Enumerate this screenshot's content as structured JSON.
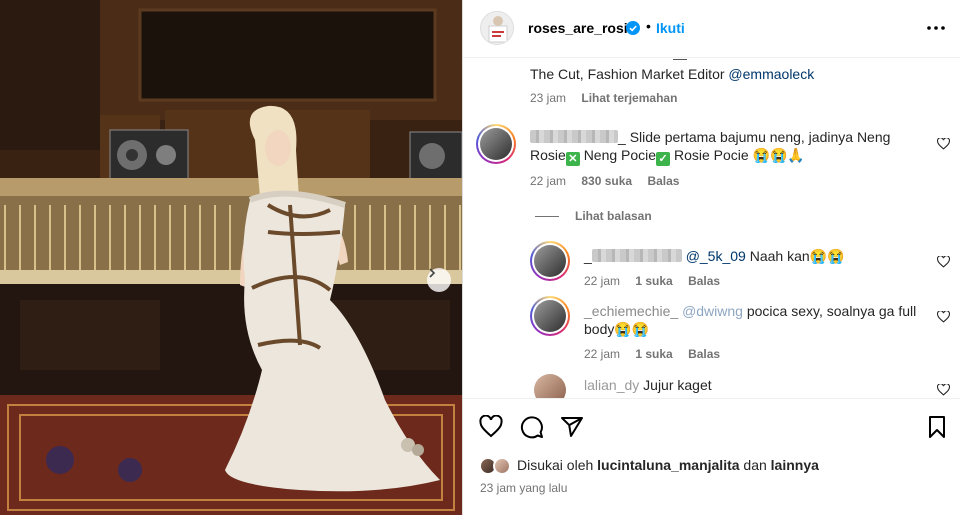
{
  "header": {
    "username": "roses_are_rosie",
    "separator": "•",
    "follow_label": "Ikuti"
  },
  "caption": {
    "line": "The Cut, Fashion Market Editor",
    "mention": "@emmaoleck",
    "time": "23 jam",
    "translate_label": "Lihat terjemahan"
  },
  "comments": [
    {
      "username_suffix": "_",
      "text_line1": "Slide pertama bajumu neng, jadinya Neng",
      "text_line2_a": "Rosie",
      "text_line2_b": "Neng Pocie",
      "text_line2_c": "Rosie Pocie 😭😭🙏",
      "time": "22 jam",
      "likes": "830 suka",
      "reply_label": "Balas"
    }
  ],
  "view_replies_label": "Lihat balasan",
  "replies": [
    {
      "username": "_",
      "mention": "@_5k_09",
      "text": "Naah kan😭😭",
      "time": "22 jam",
      "likes": "1 suka",
      "reply_label": "Balas"
    },
    {
      "username": "_echiemechie_",
      "mention": "@dwiwng",
      "text_line1": "pocica sexy, soalnya ga full",
      "text_line2": "body😭😭",
      "time": "22 jam",
      "likes": "1 suka",
      "reply_label": "Balas"
    }
  ],
  "last_comment": {
    "username": "lalian_dy",
    "text": "Jujur kaget"
  },
  "footer": {
    "liked_prefix": "Disukai oleh",
    "liked_user": "lucintaluna_manjalita",
    "liked_and": "dan",
    "liked_others": "lainnya",
    "timestamp": "23 jam yang lalu"
  },
  "colors": {
    "link": "#00376b",
    "follow": "#0095f6",
    "verified": "#0095f6",
    "muted": "#737373"
  },
  "icons": [
    "verified-badge-icon",
    "more-options-icon",
    "heart-icon",
    "comment-icon",
    "share-icon",
    "bookmark-icon",
    "chevron-right-icon"
  ]
}
